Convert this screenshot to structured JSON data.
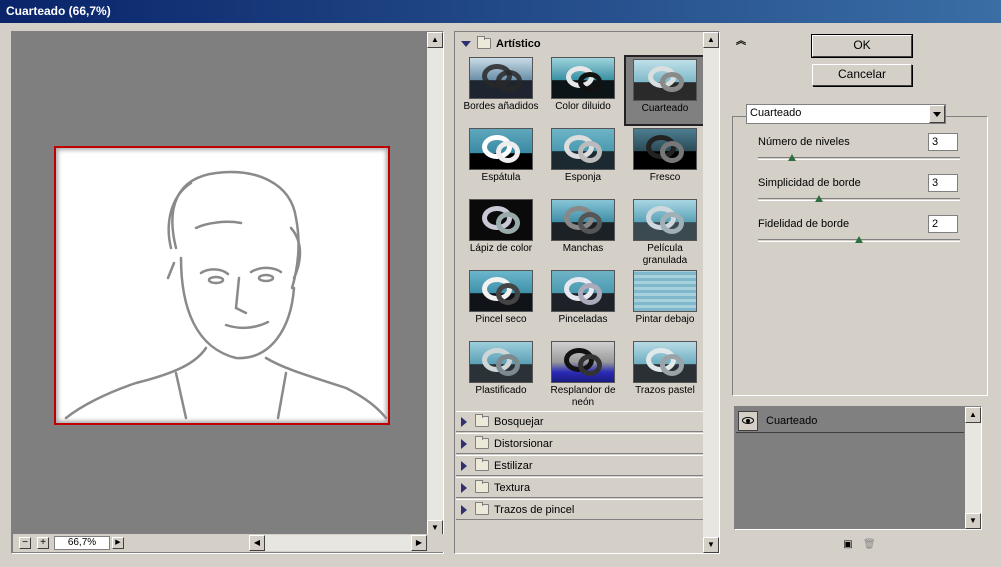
{
  "window": {
    "title": "Cuarteado (66,7%)"
  },
  "preview": {
    "zoom": "66,7%",
    "zoom_out_label": "−",
    "zoom_in_label": "+"
  },
  "gallery": {
    "open_category": "Artístico",
    "filters": [
      "Bordes añadidos",
      "Color diluido",
      "Cuarteado",
      "Espátula",
      "Esponja",
      "Fresco",
      "Lápiz de color",
      "Manchas",
      "Película granulada",
      "Pincel seco",
      "Pinceladas",
      "Pintar debajo",
      "Plastificado",
      "Resplandor de neón",
      "Trazos pastel"
    ],
    "selected_filter": "Cuarteado",
    "collapsed_categories": [
      "Bosquejar",
      "Distorsionar",
      "Estilizar",
      "Textura",
      "Trazos de pincel"
    ]
  },
  "buttons": {
    "ok": "OK",
    "cancel": "Cancelar"
  },
  "settings": {
    "filter_select": "Cuarteado",
    "params": [
      {
        "label": "Número de niveles",
        "value": "3",
        "level": 0.17
      },
      {
        "label": "Simplicidad de borde",
        "value": "3",
        "level": 0.3
      },
      {
        "label": "Fidelidad de borde",
        "value": "2",
        "level": 0.5
      }
    ]
  },
  "layers": {
    "items": [
      "Cuarteado"
    ]
  },
  "icons": {
    "collapse": "double-chevron-up-icon",
    "new_layer": "new-layer-icon",
    "delete_layer": "trash-icon",
    "visibility": "eye-icon"
  }
}
